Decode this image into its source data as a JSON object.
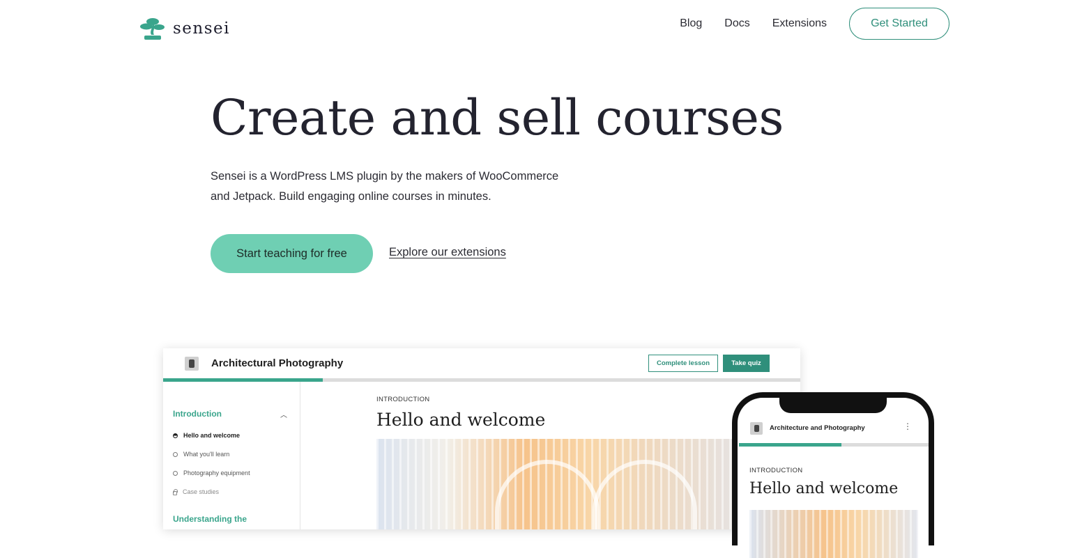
{
  "brand": {
    "name": "sensei",
    "accent": "#3aa58c",
    "primary_button_color": "#6fcfb3"
  },
  "nav": {
    "items": [
      "Blog",
      "Docs",
      "Extensions"
    ],
    "cta": "Get Started"
  },
  "hero": {
    "title": "Create and sell courses",
    "subtitle_line1": "Sensei is a WordPress LMS plugin by the makers of WooCommerce",
    "subtitle_line2": "and Jetpack. Build engaging online courses in minutes.",
    "primary_button": "Start teaching for free",
    "secondary_link": "Explore our extensions"
  },
  "desktop_mockup": {
    "course_title": "Architectural Photography",
    "complete_button": "Complete lesson",
    "quiz_button": "Take quiz",
    "progress_percent": 25,
    "section_title": "Introduction",
    "lessons": [
      {
        "label": "Hello and welcome",
        "state": "current"
      },
      {
        "label": "What you'll learn",
        "state": "open"
      },
      {
        "label": "Photography equipment",
        "state": "open"
      },
      {
        "label": "Case studies",
        "state": "locked"
      }
    ],
    "next_section_title": "Understanding the",
    "content_label": "INTRODUCTION",
    "content_title": "Hello and welcome"
  },
  "phone_mockup": {
    "course_title": "Architecture and Photography",
    "more_icon": "⋮",
    "progress_percent": 54,
    "content_label": "INTRODUCTION",
    "content_title": "Hello and welcome"
  }
}
